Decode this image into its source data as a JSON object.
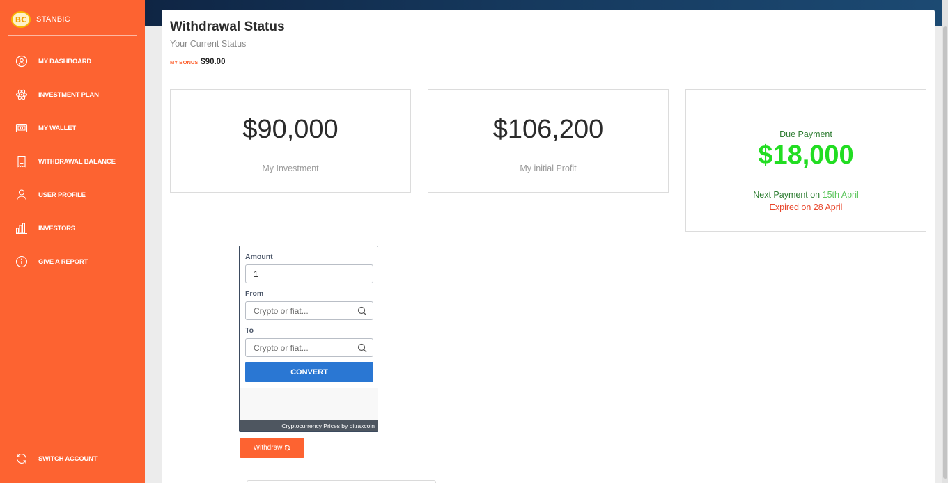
{
  "brand": {
    "logo_text": "BC",
    "name": "STANBIC"
  },
  "sidebar": {
    "items": [
      {
        "label": "MY DASHBOARD",
        "icon": "dashboard-icon"
      },
      {
        "label": "INVESTMENT PLAN",
        "icon": "atom-icon"
      },
      {
        "label": "MY WALLET",
        "icon": "wallet-icon"
      },
      {
        "label": "WITHDRAWAL BALANCE",
        "icon": "receipt-icon"
      },
      {
        "label": "USER PROFILE",
        "icon": "user-icon"
      },
      {
        "label": "INVESTORS",
        "icon": "bar-chart-icon"
      },
      {
        "label": "GIVE A REPORT",
        "icon": "info-icon"
      }
    ],
    "footer_item": {
      "label": "SWITCH ACCOUNT",
      "icon": "refresh-icon"
    }
  },
  "header": {
    "title": "Withdrawal Status",
    "subtitle": "Your Current Status",
    "bonus_label": "MY BONUS",
    "bonus_value": "$90.00"
  },
  "stats": {
    "investment": {
      "value": "$90,000",
      "label": "My Investment"
    },
    "profit": {
      "value": "$106,200",
      "label": "My initial Profit"
    },
    "due": {
      "title": "Due Payment",
      "amount": "$18,000",
      "next_prefix": "Next Payment on",
      "next_date": "15th April",
      "expired": "Expired on 28 April"
    }
  },
  "converter": {
    "amount_label": "Amount",
    "amount_value": "1",
    "from_label": "From",
    "from_placeholder": "Crypto or fiat...",
    "to_label": "To",
    "to_placeholder": "Crypto or fiat...",
    "button_label": "CONVERT",
    "footer": "Cryptocurrency Prices by bitraxcoin"
  },
  "withdraw_button": {
    "label": "Withdraw",
    "icon": "refresh-icon"
  },
  "colors": {
    "sidebar": "#fd6331",
    "accent_blue": "#2a77d3",
    "due_green": "#22dd22",
    "expired_red": "#e8452a"
  }
}
